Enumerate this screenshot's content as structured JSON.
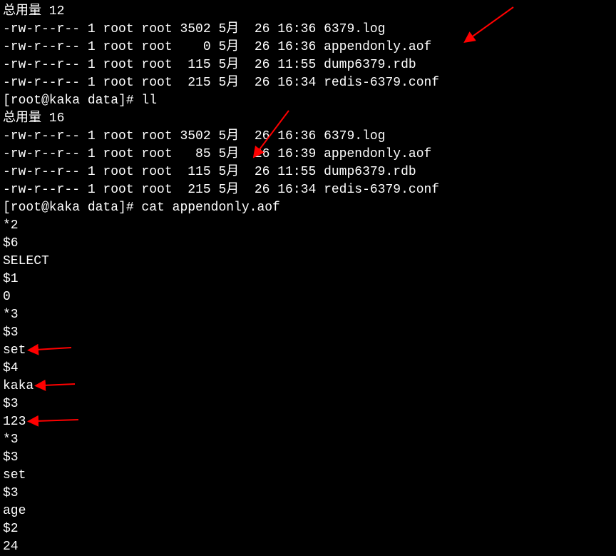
{
  "lines": [
    "总用量 12",
    "-rw-r--r-- 1 root root 3502 5月  26 16:36 6379.log",
    "-rw-r--r-- 1 root root    0 5月  26 16:36 appendonly.aof",
    "-rw-r--r-- 1 root root  115 5月  26 11:55 dump6379.rdb",
    "-rw-r--r-- 1 root root  215 5月  26 16:34 redis-6379.conf",
    "[root@kaka data]# ll",
    "总用量 16",
    "-rw-r--r-- 1 root root 3502 5月  26 16:36 6379.log",
    "-rw-r--r-- 1 root root   85 5月  26 16:39 appendonly.aof",
    "-rw-r--r-- 1 root root  115 5月  26 11:55 dump6379.rdb",
    "-rw-r--r-- 1 root root  215 5月  26 16:34 redis-6379.conf",
    "[root@kaka data]# cat appendonly.aof",
    "*2",
    "$6",
    "SELECT",
    "$1",
    "0",
    "*3",
    "$3",
    "set",
    "$4",
    "kaka",
    "$3",
    "123",
    "*3",
    "$3",
    "set",
    "$3",
    "age",
    "$2",
    "24"
  ]
}
